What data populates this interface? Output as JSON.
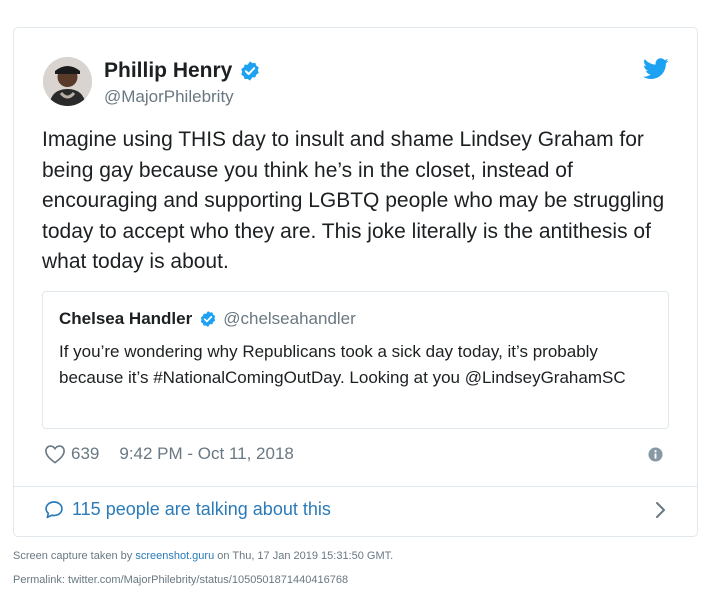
{
  "tweet": {
    "author_name": "Phillip Henry",
    "author_handle": "@MajorPhilebrity",
    "text": "Imagine using THIS day to insult and shame Lindsey Graham for being gay because you think he’s in the closet, instead of encouraging and supporting LGBTQ people who may be struggling today to accept who they are. This joke literally is the antithesis of what today is about.",
    "likes": "639",
    "timestamp": "9:42 PM - Oct 11, 2018",
    "talking_label": "115 people are talking about this"
  },
  "quote": {
    "author_name": "Chelsea Handler",
    "author_handle": "@chelseahandler",
    "text": "If you’re wondering why Republicans took a sick day today, it’s probably because it’s #NationalComingOutDay. Looking at you @LindseyGrahamSC"
  },
  "footer": {
    "capture_prefix": "Screen capture taken by",
    "capture_site": "screenshot.guru",
    "capture_suffix": "on Thu, 17 Jan 2019 15:31:50 GMT.",
    "permalink": "Permalink: twitter.com/MajorPhilebrity/status/1050501871440416768"
  },
  "icons": {
    "verified": "verified-badge-icon",
    "bird": "twitter-bird-icon",
    "heart": "heart-icon",
    "info": "info-icon",
    "bubble": "speech-bubble-icon",
    "chevron": "chevron-right-icon"
  },
  "colors": {
    "twitter_blue": "#1da1f2",
    "link_blue": "#2b7bb9",
    "gray_text": "#697882",
    "border": "#e1e8ed"
  }
}
